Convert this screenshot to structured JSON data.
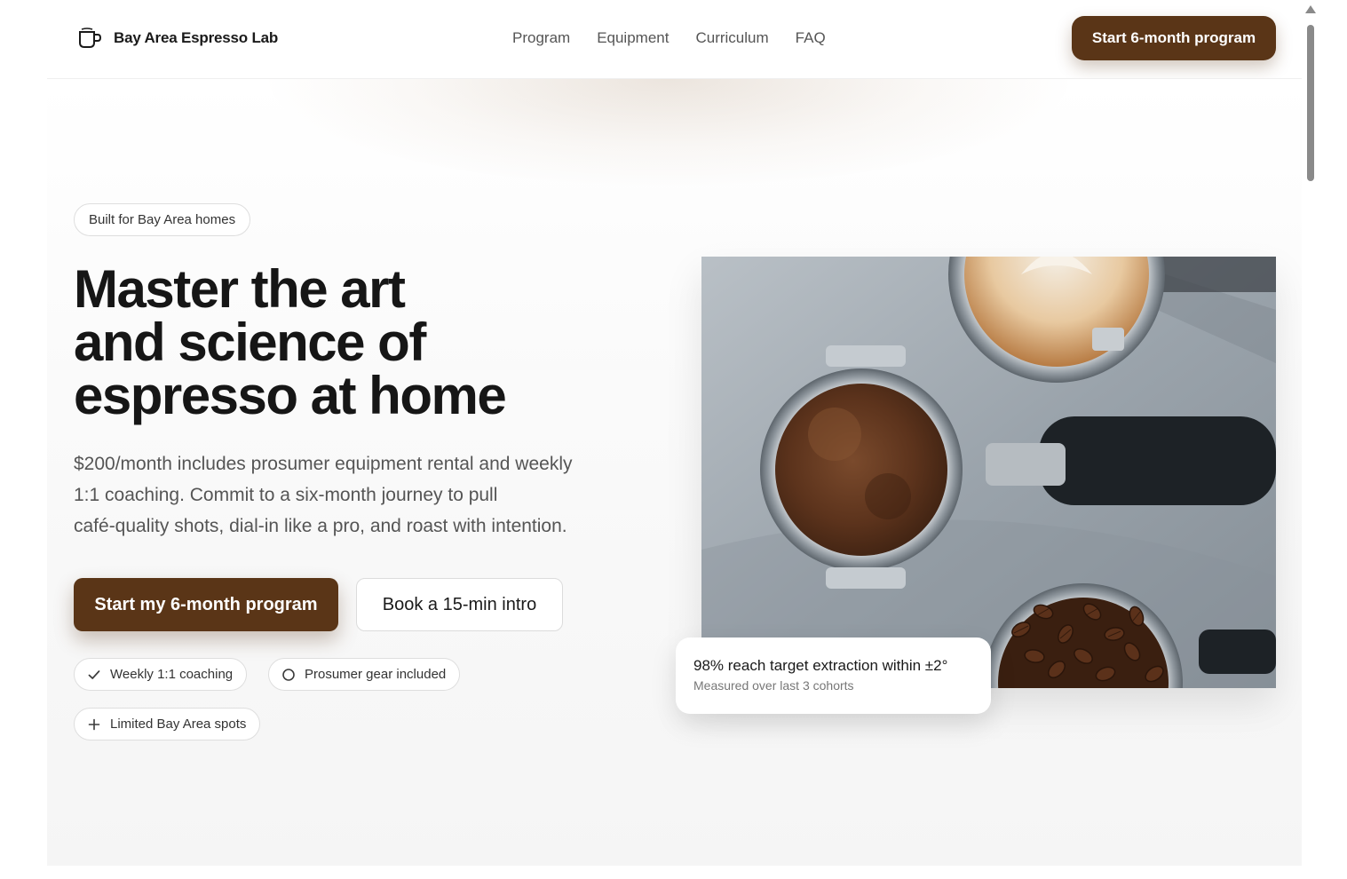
{
  "brand": {
    "name": "Bay Area Espresso Lab",
    "icon": "cup-icon"
  },
  "nav": {
    "items": [
      "Program",
      "Equipment",
      "Curriculum",
      "FAQ"
    ]
  },
  "header": {
    "cta_label": "Start 6-month program"
  },
  "hero": {
    "badge": "Built for Bay Area homes",
    "headline": [
      "Master the art",
      "and science of",
      "espresso at home"
    ],
    "subcopy": [
      "$200/month includes prosumer equipment rental and weekly",
      "1:1 coaching. Commit to a six-month journey to pull",
      "café-quality shots, dial-in like a pro, and roast with intention."
    ],
    "primary_cta": "Start my 6-month program",
    "secondary_cta": "Book a 15-min intro",
    "chips": [
      {
        "label": "Weekly 1:1 coaching",
        "icon": "check-icon"
      },
      {
        "label": "Prosumer gear included",
        "icon": "circle-icon"
      },
      {
        "label": "Limited Bay Area spots",
        "icon": "plus-icon"
      }
    ]
  },
  "stat_card": {
    "title": "98% reach target extraction within ±2°",
    "subtitle": "Measured over last 3 cohorts"
  },
  "colors": {
    "accent": "#5a3517",
    "text": "#161616",
    "muted": "#555555"
  }
}
